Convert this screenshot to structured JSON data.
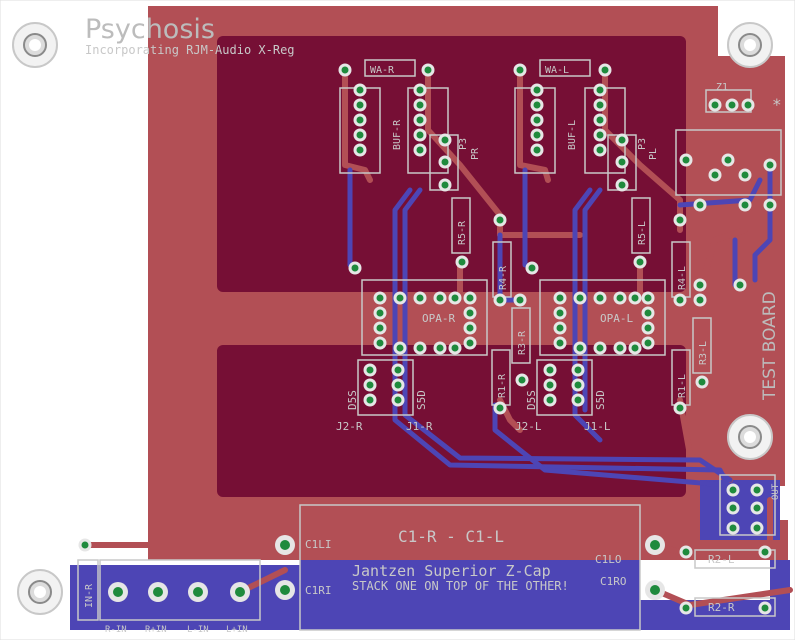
{
  "board": {
    "title": "Psychosis",
    "subtitle": "Incorporating RJM-Audio X-Reg",
    "side_label": "TEST BOARD",
    "capacitor_title": "C1-R   -   C1-L",
    "capacitor_brand": "Jantzen Superior Z-Cap",
    "capacitor_note": "STACK ONE ON TOP OF THE OTHER!",
    "colors": {
      "background": "#ffffff",
      "copper_top": "#b24f55",
      "copper_pour": "#760f35",
      "copper_bottom": "#4d45b5",
      "pad": "#1f8a3d",
      "silkscreen": "#c8c8c8"
    }
  },
  "labels": {
    "wa_r": "WA-R",
    "wa_l": "WA-L",
    "buf_r": "BUF-R",
    "buf_l": "BUF-L",
    "pr": "PR",
    "pl": "PL",
    "p3": "P3",
    "r5_r": "R5-R",
    "r5_l": "R5-L",
    "r4_r": "R4-R",
    "r4_l": "R4-L",
    "r3_r": "R3-R",
    "r3_l": "R3-L",
    "r1_r": "R1-R",
    "r1_l": "R1-L",
    "opa_r": "OPA-R",
    "opa_l": "OPA-L",
    "d5s_r": "D5S",
    "d5s_l": "D5S",
    "s5d_r": "S5D",
    "s5d_l": "S5D",
    "j2_r": "J2-R",
    "j1_r": "J1-R",
    "j2_l": "J2-L",
    "j1_l": "J1-L",
    "c1li": "C1LI",
    "c1ri": "C1RI",
    "c1lo": "C1LO",
    "c1ro": "C1RO",
    "r2_l": "R2-L",
    "r2_r": "R2-R",
    "in_r": "IN-R",
    "r_in": "R-IN",
    "r_plus_in": "R+IN",
    "l_in": "L-IN",
    "l_plus_in": "L+IN",
    "out": "OUT",
    "z1": "Z1",
    "mark": "*"
  }
}
